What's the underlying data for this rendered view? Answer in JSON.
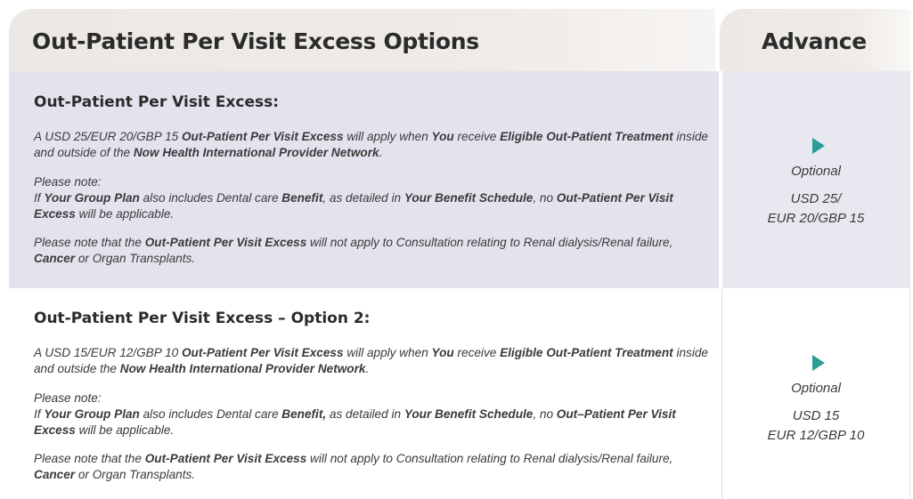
{
  "header": {
    "title": "Out-Patient Per Visit Excess Options",
    "column": "Advance"
  },
  "sections": [
    {
      "title": "Out-Patient Per Visit Excess:",
      "p1": [
        [
          "A USD 25/EUR 20/GBP 15 ",
          false
        ],
        [
          "Out-Patient Per Visit Excess",
          true
        ],
        [
          " will apply when ",
          false
        ],
        [
          "You",
          true
        ],
        [
          " receive ",
          false
        ],
        [
          "Eligible Out-Patient Treatment",
          true
        ],
        [
          " inside and outside of the ",
          false
        ],
        [
          "Now Health International Provider Network",
          true
        ],
        [
          ".",
          false
        ]
      ],
      "p2_head": "Please note:",
      "p2": [
        [
          "If ",
          false
        ],
        [
          "Your Group Plan",
          true
        ],
        [
          " also includes Dental care ",
          false
        ],
        [
          "Benefit",
          true
        ],
        [
          ", as detailed in ",
          false
        ],
        [
          "Your Benefit Schedule",
          true
        ],
        [
          ", no ",
          false
        ],
        [
          "Out-Patient Per Visit Excess",
          true
        ],
        [
          " will be applicable.",
          false
        ]
      ],
      "p3": [
        [
          "Please note that the ",
          false
        ],
        [
          "Out-Patient Per Visit Excess",
          true
        ],
        [
          " will not apply to Consultation relating to Renal dialysis/Renal failure, ",
          false
        ],
        [
          "Cancer",
          true
        ],
        [
          " or Organ Transplants.",
          false
        ]
      ],
      "option_label": "Optional",
      "option_line1": "USD 25/",
      "option_line2": "EUR 20/GBP 15"
    },
    {
      "title": "Out-Patient Per Visit Excess – Option 2:",
      "p1": [
        [
          "A USD 15/EUR 12/GBP 10 ",
          false
        ],
        [
          "Out-Patient Per Visit Excess",
          true
        ],
        [
          " will apply when ",
          false
        ],
        [
          "You",
          true
        ],
        [
          " receive ",
          false
        ],
        [
          "Eligible Out-Patient Treatment",
          true
        ],
        [
          " inside and outside the ",
          false
        ],
        [
          "Now Health International Provider Network",
          true
        ],
        [
          ".",
          false
        ]
      ],
      "p2_head": "Please note:",
      "p2": [
        [
          "If ",
          false
        ],
        [
          "Your Group Plan",
          true
        ],
        [
          " also includes Dental care ",
          false
        ],
        [
          "Benefit,",
          true
        ],
        [
          " as detailed in ",
          false
        ],
        [
          "Your Benefit Schedule",
          true
        ],
        [
          ", no ",
          false
        ],
        [
          "Out–Patient Per Visit Excess",
          true
        ],
        [
          " will be applicable.",
          false
        ]
      ],
      "p3": [
        [
          "Please note that the ",
          false
        ],
        [
          "Out-Patient Per Visit Excess",
          true
        ],
        [
          " will not apply to Consultation relating to Renal dialysis/Renal failure, ",
          false
        ],
        [
          "Cancer",
          true
        ],
        [
          " or Organ Transplants.",
          false
        ]
      ],
      "option_label": "Optional",
      "option_line1": "USD 15",
      "option_line2": "EUR 12/GBP 10"
    }
  ],
  "colors": {
    "header_bg": "#efebe7",
    "row_highlight": "#e3e3ee",
    "accent": "#2a9d96"
  }
}
